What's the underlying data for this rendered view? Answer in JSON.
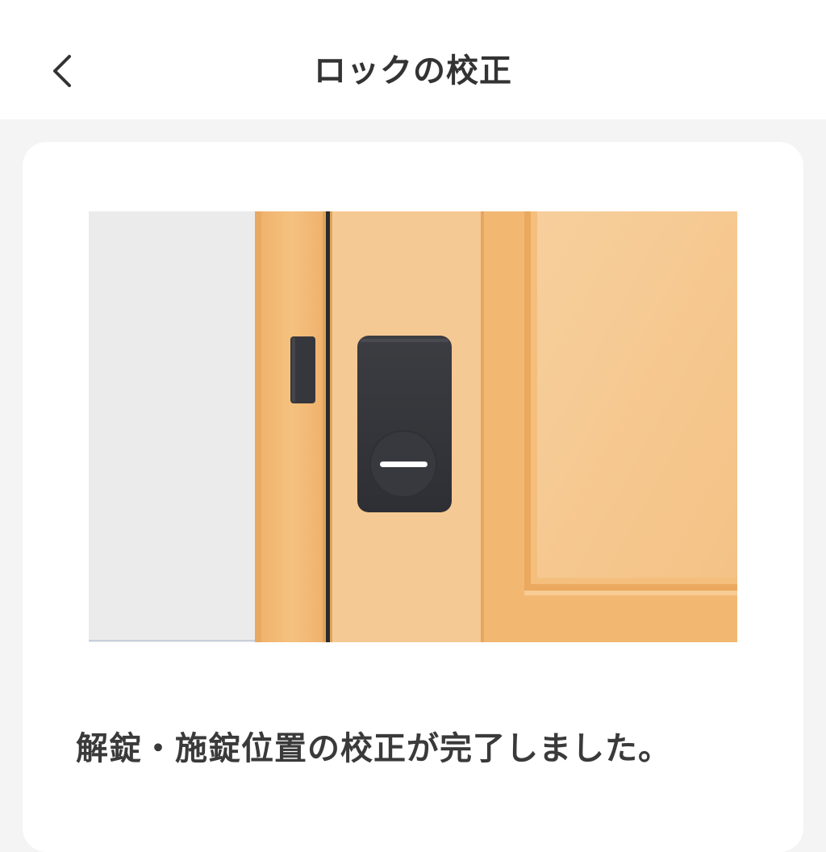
{
  "header": {
    "title": "ロックの校正",
    "back_icon": "chevron-left-icon"
  },
  "illustration": {
    "icon": "door-smart-lock-illustration",
    "colors": {
      "wall": "#ebebeb",
      "door_frame": "#f2b872",
      "door_panel": "#f5c993",
      "lock_body": "#34353a",
      "lock_indicator": "#ffffff"
    }
  },
  "main": {
    "message": "解錠・施錠位置の校正が完了しました。"
  }
}
